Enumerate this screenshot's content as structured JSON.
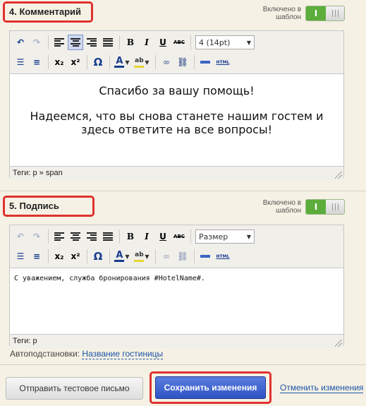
{
  "section4": {
    "title": "4. Комментарий",
    "toggle_label": "Включено в шаблон",
    "toggle_on": "I",
    "font_size": "4 (14pt)",
    "content_line1": "Спасибо за вашу помощь!",
    "content_line2": "Надеемся, что вы снова станете нашим гостем и здесь ответите на все вопросы!",
    "path": "Теги: p » span"
  },
  "section5": {
    "title": "5. Подпись",
    "toggle_label": "Включено в шаблон",
    "toggle_on": "I",
    "font_size": "Размер",
    "content": "С уважением, служба бронирования #HotelName#.",
    "path": "Теги: p"
  },
  "toolbar": {
    "bold": "B",
    "italic": "I",
    "underline": "U",
    "strike": "ABC",
    "subscript": "x₂",
    "superscript": "x²",
    "omega": "Ω",
    "font_color": "A",
    "highlight": "ab",
    "html": "HTML"
  },
  "autosub": {
    "label": "Автоподстановки:",
    "link": "Название гостиницы"
  },
  "footer": {
    "test_button": "Отправить тестовое письмо",
    "save_button": "Сохранить изменения",
    "cancel_link": "Отменить изменения"
  },
  "colors": {
    "highlight_red": "#e0322f",
    "toggle_green": "#5cad3c",
    "save_blue": "#2f52c4",
    "link_blue": "#1a54a8"
  }
}
